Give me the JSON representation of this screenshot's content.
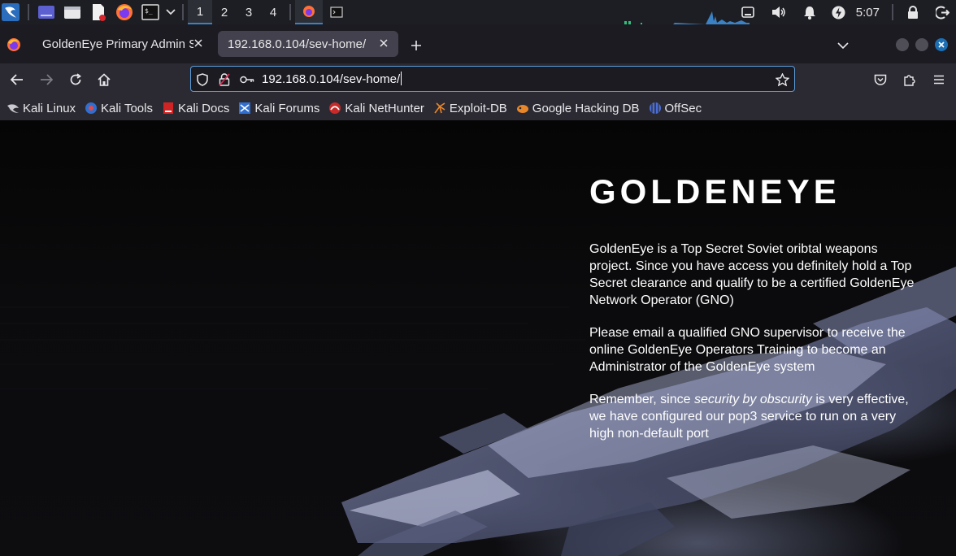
{
  "taskbar": {
    "workspaces": [
      "1",
      "2",
      "3",
      "4"
    ],
    "active_workspace": "1",
    "clock": "5:07",
    "icons": [
      "kali-dragon-icon",
      "desktop-icon",
      "file-manager-icon",
      "text-editor-icon",
      "firefox-icon",
      "terminal-icon",
      "chevron-down-icon"
    ],
    "tray_icons": [
      "network-icon",
      "volume-icon",
      "notification-bell-icon",
      "power-icon",
      "lock-icon",
      "logout-icon"
    ]
  },
  "browser": {
    "tabs": [
      {
        "title": "GoldenEye Primary Admin Server",
        "active": false
      },
      {
        "title": "192.168.0.104/sev-home/",
        "active": true
      }
    ],
    "url": "192.168.0.104/sev-home/",
    "bookmarks": [
      {
        "label": "Kali Linux",
        "icon": "kali-icon"
      },
      {
        "label": "Kali Tools",
        "icon": "kali-tools-icon"
      },
      {
        "label": "Kali Docs",
        "icon": "kali-docs-icon"
      },
      {
        "label": "Kali Forums",
        "icon": "kali-forums-icon"
      },
      {
        "label": "Kali NetHunter",
        "icon": "nethunter-icon"
      },
      {
        "label": "Exploit-DB",
        "icon": "exploit-db-icon"
      },
      {
        "label": "Google Hacking DB",
        "icon": "ghdb-icon"
      },
      {
        "label": "OffSec",
        "icon": "offsec-icon"
      }
    ]
  },
  "page": {
    "title": "GOLDENEYE",
    "paragraph1": "GoldenEye is a Top Secret Soviet oribtal weapons project. Since you have access you definitely hold a Top Secret clearance and qualify to be a certified GoldenEye Network Operator (GNO)",
    "paragraph2": "Please email a qualified GNO supervisor to receive the online GoldenEye Operators Training to become an Administrator of the GoldenEye system",
    "paragraph3_pre": "Remember, since ",
    "paragraph3_em": "security by obscurity",
    "paragraph3_post": " is very effective, we have configured our pop3 service to run on a very high non-default port"
  },
  "colors": {
    "accent": "#3b82c4",
    "taskbar_bg": "#1d1e23",
    "toolbar_bg": "#2b2a33",
    "page_text": "#ffffff"
  }
}
